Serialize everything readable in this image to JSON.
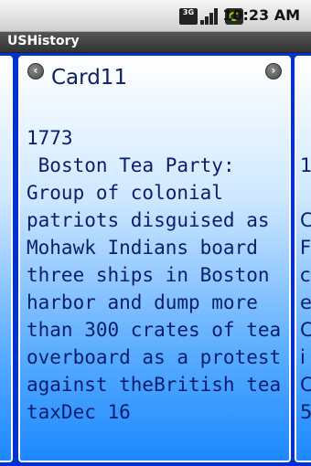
{
  "status_bar": {
    "time": "10:23 AM",
    "network_label": "3G",
    "icons": [
      "network-3g-icon",
      "signal-strength-icon",
      "battery-sync-icon"
    ]
  },
  "app": {
    "title": "USHistory"
  },
  "card": {
    "title": "Card11",
    "year": "1773",
    "text": " Boston Tea Party:\nGroup of colonial\npatriots disguised as\nMohawk Indians board\nthree ships in Boston\nharbor and dump more\nthan 300 crates of tea\noverboard as a protest\nagainst theBritish tea\ntaxDec 16"
  },
  "next_card_peek": {
    "lines": [
      "1",
      "",
      "C",
      "F",
      "c",
      "e",
      "C",
      "i",
      "C",
      "5"
    ]
  },
  "colors": {
    "page_background": "#0033cc",
    "card_text": "#0a1e6b",
    "title_bar": "#3c3c3c"
  }
}
